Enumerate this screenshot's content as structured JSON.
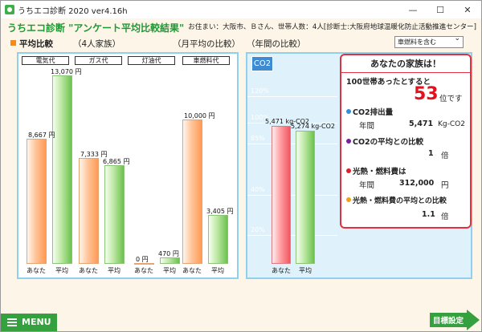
{
  "window": {
    "title": "うちエコ診断 2020 ver4.16h",
    "minimize": "—",
    "maximize": "☐",
    "close": "✕"
  },
  "header": {
    "heading": "うちエコ診断  \"アンケート平均比較結果\"",
    "residence": "お住まい：大阪市、Ｂさん、世帯人数：4人[診断士:大阪府地球温暖化防止活動推進センター]"
  },
  "monthly": {
    "label": "平均比較",
    "household": "（4人家族）",
    "subtitle": "（月平均の比較）",
    "columns": [
      {
        "name": "電気代",
        "you_label": "8,667 円",
        "avg_label": "13,070 円",
        "you": 8667,
        "avg": 13070
      },
      {
        "name": "ガス代",
        "you_label": "7,333 円",
        "avg_label": "6,865 円",
        "you": 7333,
        "avg": 6865
      },
      {
        "name": "灯油代",
        "you_label": "0 円",
        "avg_label": "470 円",
        "you": 0,
        "avg": 470
      },
      {
        "name": "車燃料代",
        "you_label": "10,000 円",
        "avg_label": "3,405 円",
        "you": 10000,
        "avg": 3405
      }
    ],
    "you_text": "あなた",
    "avg_text": "平均"
  },
  "annual": {
    "label": "（年間の比較）",
    "select": "車燃料を含む",
    "tab": "CO2",
    "ticks": [
      "120%",
      "100%",
      "85%",
      "40%",
      "20%"
    ],
    "you_label": "5,471 kg-CO2",
    "avg_label": "5,274 kg-CO2",
    "you": 5471,
    "avg": 5274,
    "you_text": "あなた",
    "avg_text": "平均"
  },
  "result": {
    "title": "あなたの家族は！",
    "rank_prefix": "100世帯あったとすると",
    "rank": "53",
    "rank_suffix": "位です",
    "co2_heading": "CO2排出量",
    "year": "年間",
    "co2_value": "5,471",
    "co2_unit": "Kg-CO2",
    "co2_avg_heading": "CO2の平均との比較",
    "co2_ratio": "1",
    "times": "倍",
    "cost_heading": "光熱・燃料費は",
    "cost_year": "年間",
    "cost_value": "312,000",
    "cost_unit": "円",
    "cost_avg_heading": "光熱・燃料費の平均との比較",
    "cost_ratio": "1.1",
    "cost_times": "倍",
    "colors": {
      "co2": "#2f8fe0",
      "co2avg": "#7a1fa2",
      "cost": "#e0202a",
      "costavg": "#f2a21a"
    }
  },
  "footer": {
    "menu": "MENU",
    "goal": "目標設定"
  },
  "chart_data": [
    {
      "type": "bar",
      "title": "平均比較（月平均の比較）",
      "categories": [
        "電気代",
        "ガス代",
        "灯油代",
        "車燃料代"
      ],
      "series": [
        {
          "name": "あなた",
          "values": [
            8667,
            7333,
            0,
            10000
          ]
        },
        {
          "name": "平均",
          "values": [
            13070,
            6865,
            470,
            3405
          ]
        }
      ]
    },
    {
      "type": "bar",
      "title": "年間の比較",
      "categories": [
        "あなた",
        "平均"
      ],
      "values": [
        5471,
        5274
      ]
    }
  ]
}
